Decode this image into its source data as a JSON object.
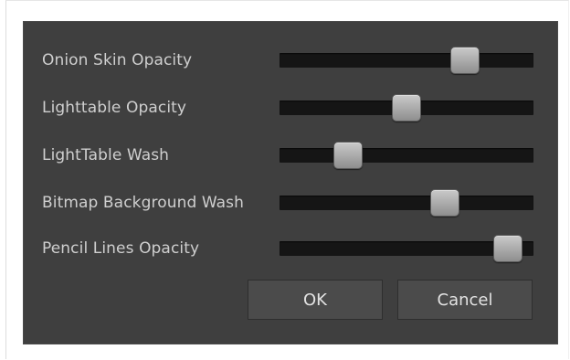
{
  "dialog": {
    "sliders": [
      {
        "label": "Onion Skin Opacity",
        "value": 0.76
      },
      {
        "label": "Lighttable Opacity",
        "value": 0.5
      },
      {
        "label": "LightTable Wash",
        "value": 0.24
      },
      {
        "label": "Bitmap Background Wash",
        "value": 0.67
      },
      {
        "label": "Pencil Lines Opacity",
        "value": 0.95
      }
    ],
    "buttons": {
      "ok_label": "OK",
      "cancel_label": "Cancel"
    }
  },
  "colors": {
    "dialog_background": "#3f3f3f",
    "track": "#151515",
    "text": "#cfcfcf",
    "button": "#4b4b4b"
  }
}
